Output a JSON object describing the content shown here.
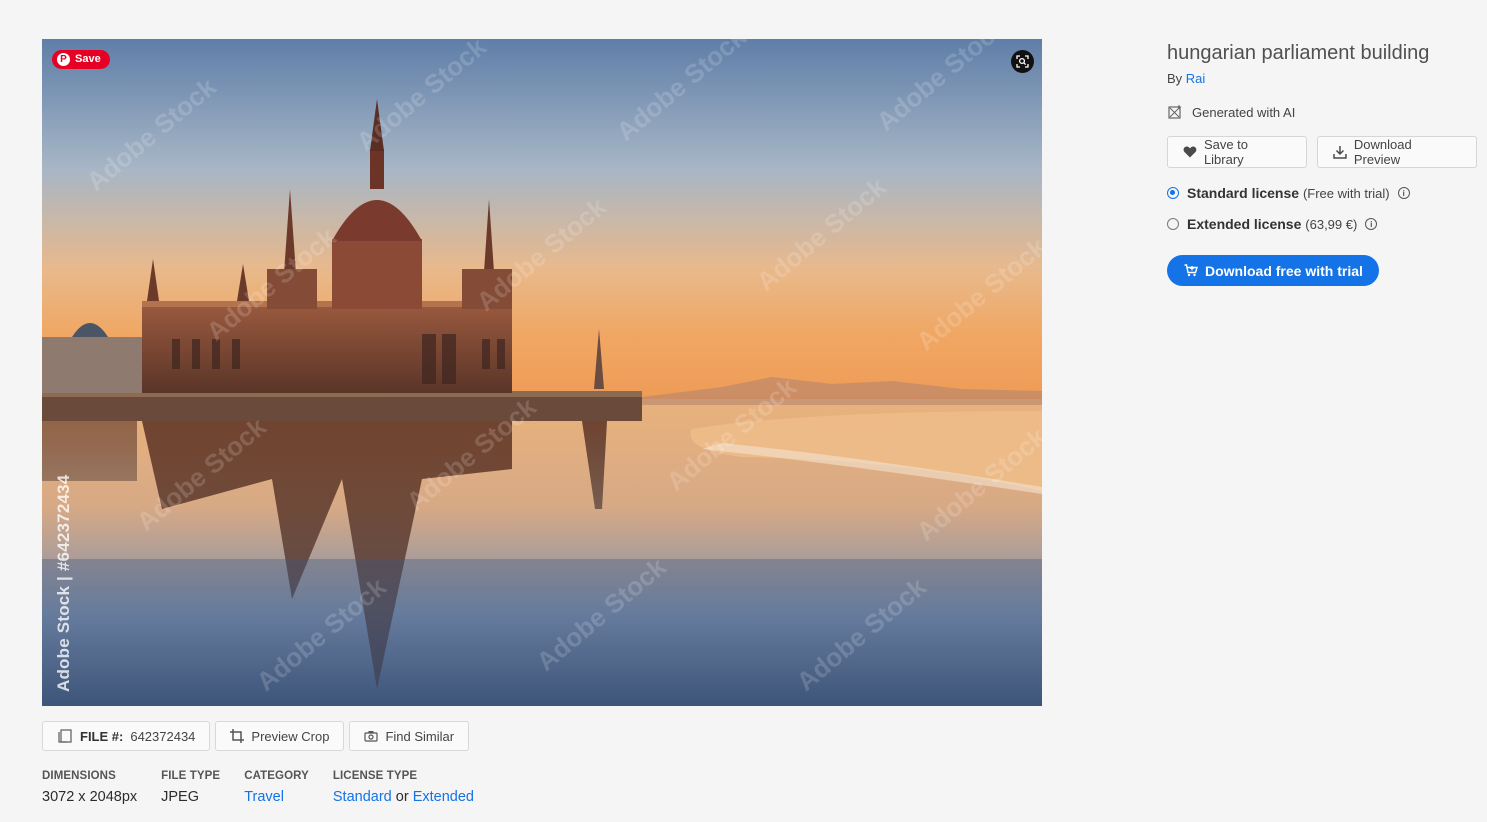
{
  "image": {
    "pinterest_save_label": "Save",
    "vertical_id_text": "Adobe Stock | #642372434",
    "watermark_text": "Adobe Stock"
  },
  "toolbar": {
    "file_label": "FILE #:",
    "file_number": "642372434",
    "preview_crop_label": "Preview Crop",
    "find_similar_label": "Find Similar"
  },
  "meta": {
    "dimensions_label": "DIMENSIONS",
    "dimensions_value": "3072 x 2048px",
    "file_type_label": "FILE TYPE",
    "file_type_value": "JPEG",
    "category_label": "CATEGORY",
    "category_value": "Travel",
    "license_type_label": "LICENSE TYPE",
    "license_standard": "Standard",
    "license_or": "or",
    "license_extended": "Extended"
  },
  "panel": {
    "title": "hungarian parliament building",
    "by_prefix": "By",
    "author": "Rai",
    "ai_label": "Generated with AI",
    "save_library_label": "Save to Library",
    "download_preview_label": "Download Preview",
    "licenses": [
      {
        "name": "Standard license",
        "note": "(Free with trial)",
        "selected": true
      },
      {
        "name": "Extended license",
        "note": "(63,99 €)",
        "selected": false
      }
    ],
    "cta_label": "Download free with trial"
  },
  "colors": {
    "accent": "#1473e6",
    "pinterest": "#e60023"
  }
}
